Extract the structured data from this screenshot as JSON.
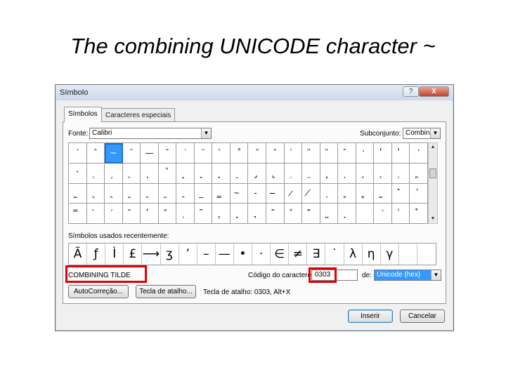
{
  "slide": {
    "title": "The combining UNICODE character ~"
  },
  "dialog": {
    "title": "Símbolo",
    "help_button": "?",
    "close_button": "X",
    "tabs": [
      {
        "label": "Símbolos"
      },
      {
        "label": "Caracteres especiais"
      }
    ],
    "font_label": "Fonte:",
    "font_value": "Calibri",
    "subset_label": "Subconjunto:",
    "subset_value": "Combina",
    "symbol_grid": [
      "´",
      "ˆ",
      "~",
      "¯",
      "—",
      "˘",
      "˙",
      "¨",
      "̉",
      "˚",
      "˝",
      "ˇ",
      "̍",
      "̎",
      "̏",
      "̑",
      "̒",
      "̓",
      "̔",
      "̕",
      "̛",
      "̜",
      "̗",
      "̘",
      "̙",
      "̚",
      "̝",
      "̞",
      "̟",
      "̠",
      "̡",
      "̢",
      "̣",
      "̤",
      "̥",
      "̦",
      "̧",
      "̨",
      "̩",
      "̪",
      "̫",
      "̬",
      "̭",
      "̮",
      "̯",
      "̰",
      "̱",
      "̲",
      "̳",
      "̴",
      "̵",
      "̶",
      "̷",
      "̸",
      "̹",
      "̺",
      "̻",
      "̼",
      "̽",
      "̾",
      "̿",
      "̀",
      "́",
      "͂",
      "̓",
      "̈́",
      "ͅ",
      "͆",
      "͇",
      "͈",
      "͉",
      "͊",
      "͋",
      "͌",
      "͍",
      "͎",
      "͏",
      "͐",
      "͑",
      "͒"
    ],
    "selected_index": 2,
    "recent_label": "Símbolos usados recentemente:",
    "recent_symbols": [
      "Ã",
      "ƒ",
      "Ì",
      "£",
      "⟶",
      "ʒ",
      "’",
      "–",
      "—",
      "•",
      "·",
      "∈",
      "≠",
      "∃",
      "˙",
      "λ",
      "η",
      "γ",
      "",
      ""
    ],
    "char_name": "COMBINING TILDE",
    "char_code_label": "Código do caractere:",
    "char_code_value": "0303",
    "from_label": "de:",
    "from_value": "Unicode (hex)",
    "autocorrect_button": "AutoCorreção...",
    "shortcut_key_button": "Tecla de atalho...",
    "shortcut_text": "Tecla de atalho: 0303, Alt+X",
    "insert_button": "Inserir",
    "cancel_button": "Cancelar",
    "highlight_color": "#e30000"
  }
}
